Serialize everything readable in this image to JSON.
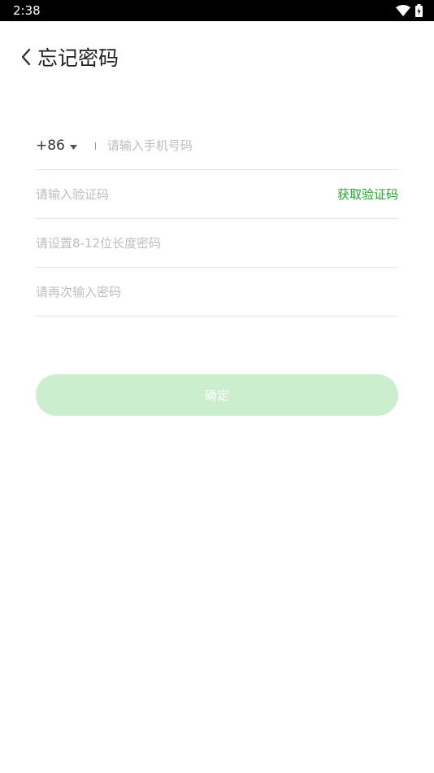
{
  "status_bar": {
    "time": "2:38",
    "icons": [
      "wifi-icon",
      "battery-charging-icon"
    ]
  },
  "header": {
    "back_icon": "chevron-left-icon",
    "title": "忘记密码"
  },
  "form": {
    "country_code": "+86",
    "phone_placeholder": "请输入手机号码",
    "code_placeholder": "请输入验证码",
    "get_code_label": "获取验证码",
    "password_placeholder": "请设置8-12位长度密码",
    "confirm_password_placeholder": "请再次输入密码"
  },
  "submit": {
    "label": "确定"
  },
  "colors": {
    "accent": "#1fa72a",
    "button_disabled": "#cbeece",
    "divider": "#e3e3e3",
    "placeholder": "#bdbdbd"
  }
}
